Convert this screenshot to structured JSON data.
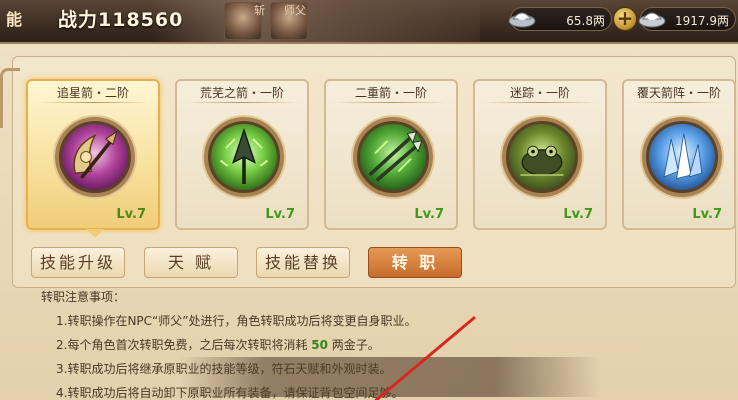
{
  "header": {
    "left_char": "能",
    "power_label": "战力118560",
    "mini_labels": [
      "斩",
      "师父"
    ],
    "silver": "65.8两",
    "gold": "1917.9两",
    "plus_label": "+"
  },
  "cards": [
    {
      "title": "追星箭・二阶",
      "level": "Lv.7",
      "icon": "crescent-blade-icon",
      "selected": true
    },
    {
      "title": "荒芜之箭・一阶",
      "level": "Lv.7",
      "icon": "green-spear-icon",
      "selected": false
    },
    {
      "title": "二重箭・一阶",
      "level": "Lv.7",
      "icon": "twin-arrow-icon",
      "selected": false
    },
    {
      "title": "迷踪・一阶",
      "level": "Lv.7",
      "icon": "stealth-frog-icon",
      "selected": false
    },
    {
      "title": "覆天箭阵・一阶",
      "level": "Lv.7",
      "icon": "ice-crystal-icon",
      "selected": false
    }
  ],
  "tabs": [
    {
      "label": "技能升级",
      "active": false
    },
    {
      "label": "天 赋",
      "active": false
    },
    {
      "label": "技能替换",
      "active": false
    },
    {
      "label": "转 职",
      "active": true
    }
  ],
  "notes": {
    "heading": "转职注意事项：",
    "line1": "1.转职操作在NPC“师父”处进行，角色转职成功后将变更自身职业。",
    "line2_pre": "2.每个角色首次转职免费，之后每次转职将消耗 ",
    "line2_num": "50",
    "line2_post": " 两金子。",
    "line3": "3.转职成功后将继承原职业的技能等级，符石天赋和外观时装。",
    "line4": "4.转职成功后将自动卸下原职业所有装备，请保证背包空间足够。"
  },
  "colors": {
    "accent_orange": "#c86c2b",
    "level_green": "#3f9a1c",
    "annotation_red": "#d8281e"
  }
}
